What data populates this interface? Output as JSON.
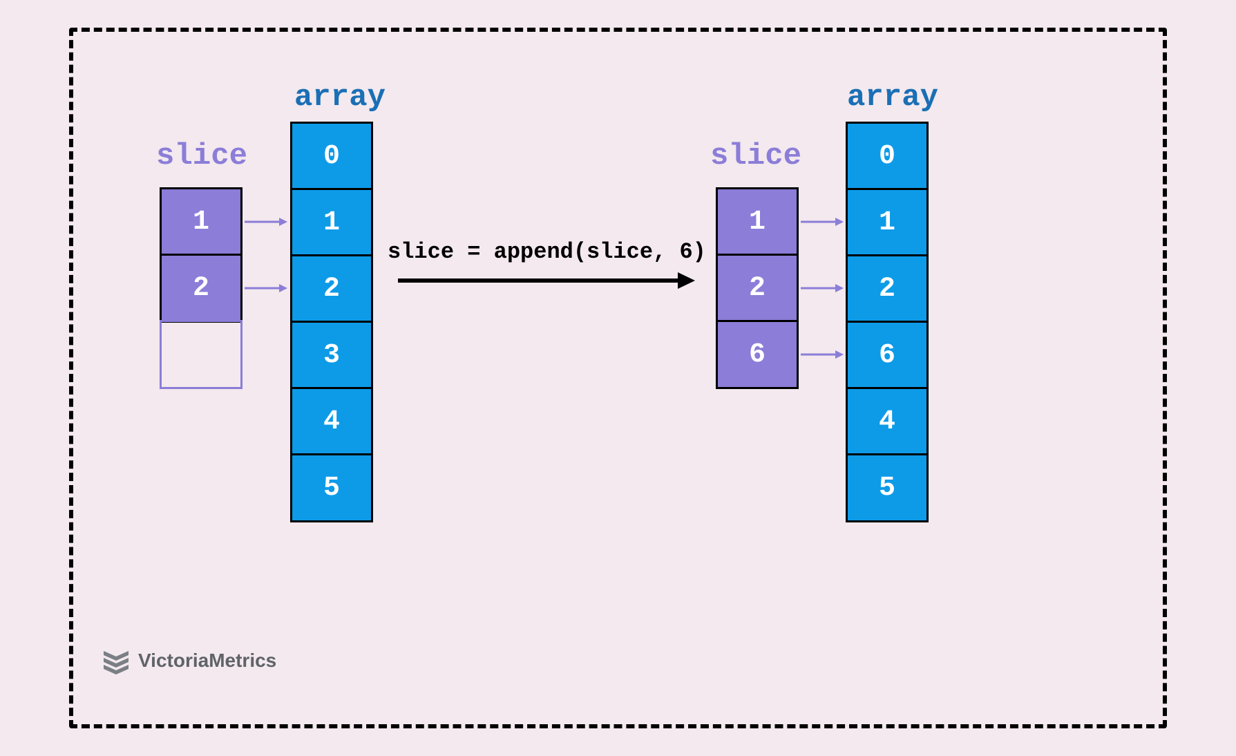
{
  "labels": {
    "slice_left": "slice",
    "array_left": "array",
    "slice_right": "slice",
    "array_right": "array"
  },
  "code": "slice = append(slice, 6)",
  "left": {
    "slice": [
      "1",
      "2",
      ""
    ],
    "array": [
      "0",
      "1",
      "2",
      "3",
      "4",
      "5"
    ]
  },
  "right": {
    "slice": [
      "1",
      "2",
      "6"
    ],
    "array": [
      "0",
      "1",
      "2",
      "6",
      "4",
      "5"
    ]
  },
  "logo": "VictoriaMetrics",
  "colors": {
    "bg": "#f3e9ee",
    "blue": "#0d9be8",
    "purple": "#8b7dd8",
    "labelBlue": "#1a6fb5"
  }
}
